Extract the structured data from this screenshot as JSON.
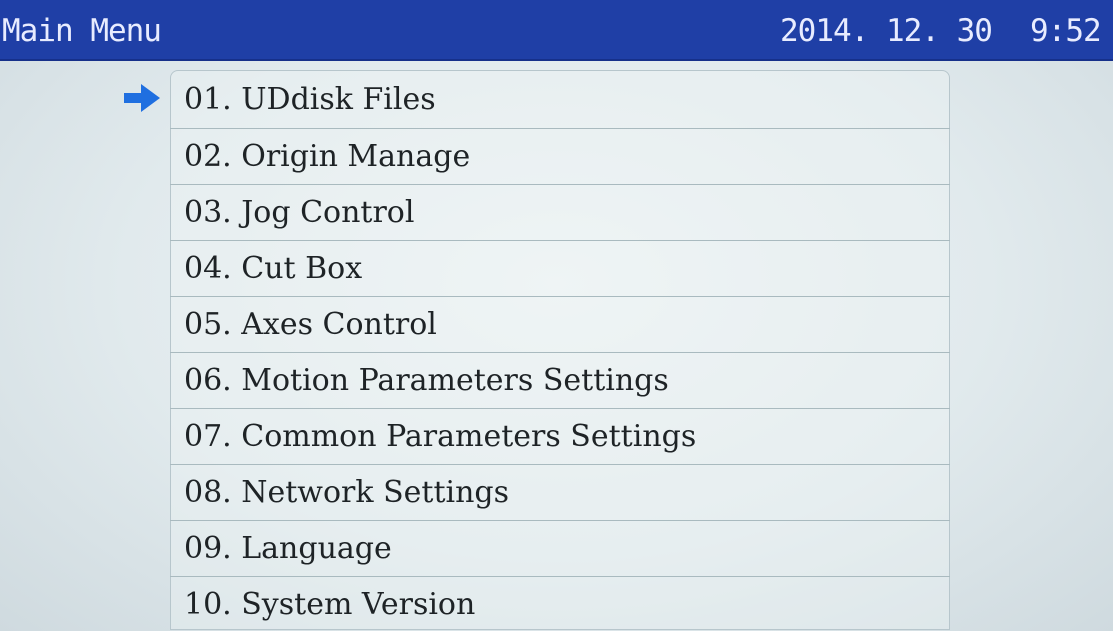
{
  "header": {
    "title": "Main Menu",
    "date": "2014. 12. 30",
    "time": "9:52"
  },
  "menu": {
    "selected_index": 0,
    "items": [
      {
        "label": "01. UDdisk Files"
      },
      {
        "label": "02. Origin Manage"
      },
      {
        "label": "03. Jog Control"
      },
      {
        "label": "04. Cut Box"
      },
      {
        "label": "05. Axes Control"
      },
      {
        "label": "06. Motion Parameters Settings"
      },
      {
        "label": "07. Common Parameters Settings"
      },
      {
        "label": "08. Network Settings"
      },
      {
        "label": "09. Language"
      },
      {
        "label": "10. System Version"
      }
    ]
  },
  "icons": {
    "pointer": "arrow-right-icon"
  },
  "colors": {
    "titlebar": "#1f3fa6",
    "title_text": "#e8ecff",
    "pointer": "#1f6fe0",
    "screen_bg": "#e2ecef",
    "menu_text": "#1e2326"
  }
}
